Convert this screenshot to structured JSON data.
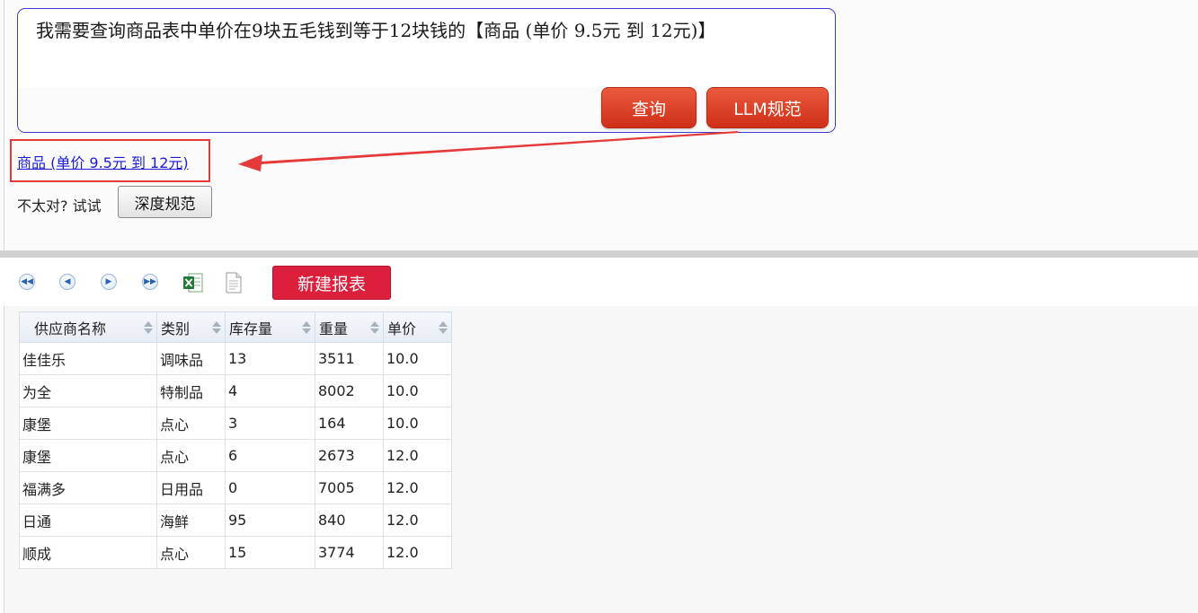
{
  "query": {
    "text": "我需要查询商品表中单价在9块五毛钱到等于12块钱的【商品 (单价 9.5元 到 12元)】",
    "query_button": "查询",
    "llm_button": "LLM规范"
  },
  "result": {
    "link_text": "商品 (单价 9.5元 到 12元)",
    "hint": "不太对? 试试",
    "deep_button": "深度规范"
  },
  "colors": {
    "accent_red": "#dc1f3b",
    "annotation_red": "#e63a3a",
    "link_blue": "#1b1bd6",
    "box_border": "#3a3acf"
  },
  "toolbar": {
    "icons": [
      "first-page-icon",
      "prev-page-icon",
      "next-page-icon",
      "last-page-icon",
      "excel-export-icon",
      "text-export-icon"
    ],
    "new_report": "新建报表"
  },
  "table": {
    "columns": [
      "供应商名称",
      "类别",
      "库存量",
      "重量",
      "单价"
    ],
    "rows": [
      [
        "佳佳乐",
        "调味品",
        "13",
        "3511",
        "10.0"
      ],
      [
        "为全",
        "特制品",
        "4",
        "8002",
        "10.0"
      ],
      [
        "康堡",
        "点心",
        "3",
        "164",
        "10.0"
      ],
      [
        "康堡",
        "点心",
        "6",
        "2673",
        "12.0"
      ],
      [
        "福满多",
        "日用品",
        "0",
        "7005",
        "12.0"
      ],
      [
        "日通",
        "海鲜",
        "95",
        "840",
        "12.0"
      ],
      [
        "顺成",
        "点心",
        "15",
        "3774",
        "12.0"
      ]
    ]
  }
}
